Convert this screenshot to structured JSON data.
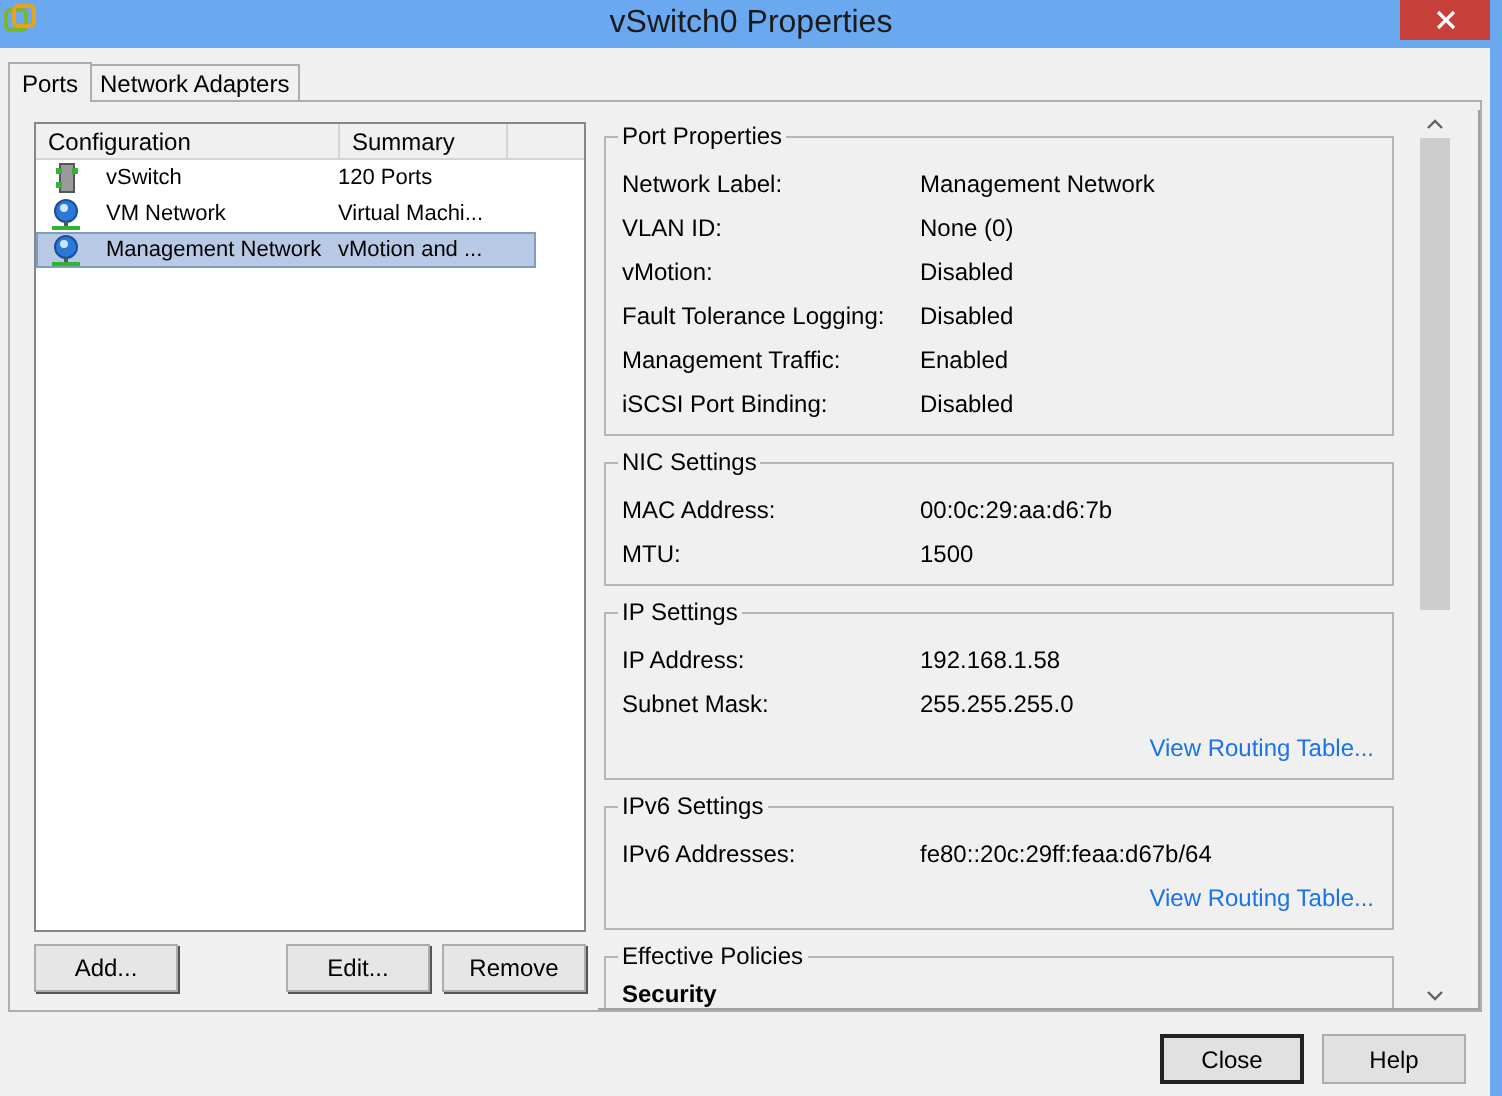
{
  "window": {
    "title": "vSwitch0 Properties"
  },
  "tabs": [
    {
      "label": "Ports",
      "selected": true
    },
    {
      "label": "Network Adapters",
      "selected": false
    }
  ],
  "config_list": {
    "columns": [
      "Configuration",
      "Summary"
    ],
    "rows": [
      {
        "kind": "switch",
        "configuration": "vSwitch",
        "summary": "120 Ports",
        "selected": false
      },
      {
        "kind": "network",
        "configuration": "VM Network",
        "summary": "Virtual Machi...",
        "selected": false
      },
      {
        "kind": "network",
        "configuration": "Management Network",
        "summary": "vMotion and ...",
        "selected": true
      }
    ]
  },
  "list_buttons": [
    "Add...",
    "Edit...",
    "Remove"
  ],
  "sections": [
    {
      "title": "Port Properties",
      "fields": [
        {
          "label": "Network Label:",
          "value": "Management Network"
        },
        {
          "label": "VLAN ID:",
          "value": "None (0)"
        },
        {
          "label": "vMotion:",
          "value": "Disabled"
        },
        {
          "label": "Fault Tolerance Logging:",
          "value": "Disabled"
        },
        {
          "label": "Management Traffic:",
          "value": "Enabled"
        },
        {
          "label": "iSCSI Port Binding:",
          "value": "Disabled"
        }
      ]
    },
    {
      "title": "NIC Settings",
      "fields": [
        {
          "label": "MAC Address:",
          "value": "00:0c:29:aa:d6:7b"
        },
        {
          "label": "MTU:",
          "value": "1500"
        }
      ]
    },
    {
      "title": "IP Settings",
      "fields": [
        {
          "label": "IP Address:",
          "value": "192.168.1.58"
        },
        {
          "label": "Subnet Mask:",
          "value": "255.255.255.0"
        }
      ],
      "link": "View Routing Table..."
    },
    {
      "title": "IPv6 Settings",
      "fields": [
        {
          "label": "IPv6 Addresses:",
          "value": "fe80::20c:29ff:feaa:d67b/64"
        }
      ],
      "link": "View Routing Table..."
    },
    {
      "title": "Effective Policies",
      "subheading": "Security"
    }
  ],
  "dialog_buttons": [
    "Close",
    "Help"
  ]
}
